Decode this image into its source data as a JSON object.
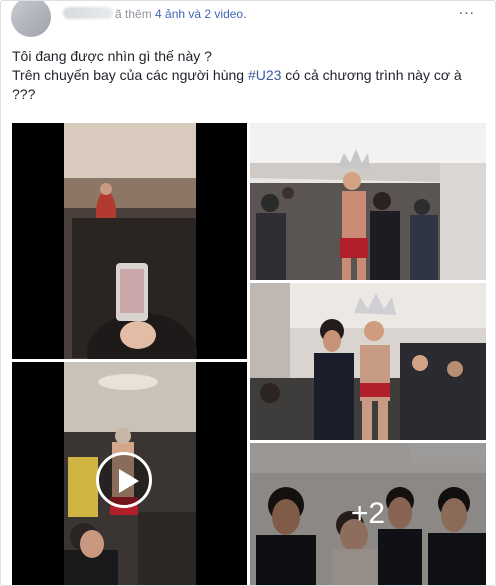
{
  "post": {
    "meta_prefix": "ã thêm",
    "meta_link": "4 ảnh và 2 video",
    "meta_suffix": ".",
    "more_label": "...",
    "line1": "Tôi đang được nhìn gì thế này ?",
    "line2_before": "Trên chuyến bay của các người hùng ",
    "hashtag": "#U23",
    "line2_after": " có cả chương trình này cơ à",
    "line3": "???"
  },
  "grid": {
    "plus_count": "+2"
  },
  "colors": {
    "link": "#4267b2",
    "hashtag": "#365899",
    "text": "#1d2129",
    "meta": "#90949c"
  }
}
